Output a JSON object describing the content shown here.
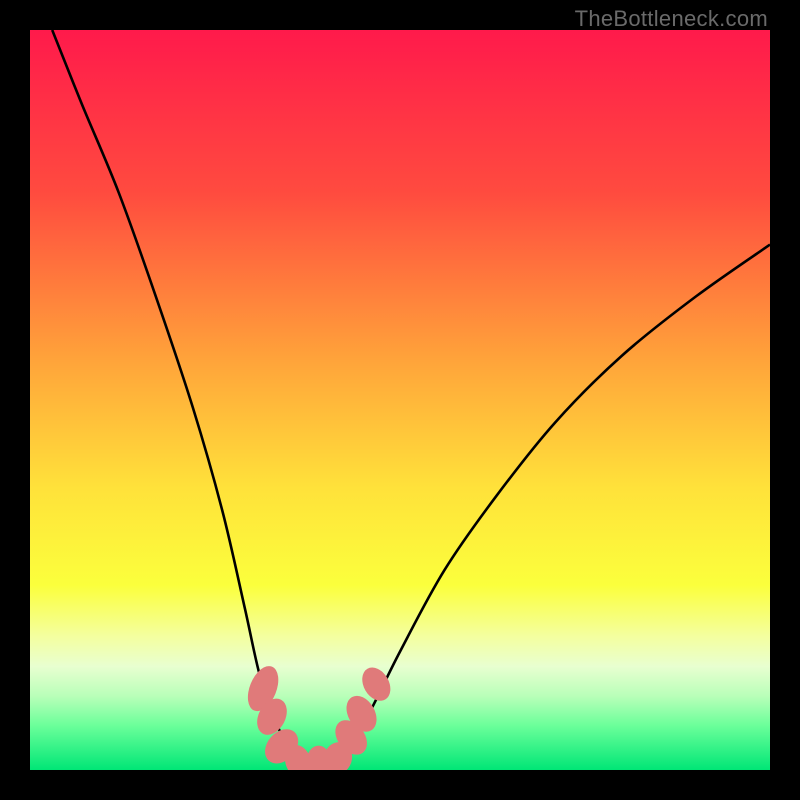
{
  "watermark": "TheBottleneck.com",
  "chart_data": {
    "type": "line",
    "title": "",
    "xlabel": "",
    "ylabel": "",
    "x_range": [
      0,
      100
    ],
    "y_range": [
      0,
      100
    ],
    "gradient_stops": [
      {
        "offset": 0,
        "color": "#ff1a4b"
      },
      {
        "offset": 22,
        "color": "#ff4b3f"
      },
      {
        "offset": 45,
        "color": "#ffa53a"
      },
      {
        "offset": 62,
        "color": "#ffe23a"
      },
      {
        "offset": 75,
        "color": "#fbff3c"
      },
      {
        "offset": 82,
        "color": "#f4ffa0"
      },
      {
        "offset": 86,
        "color": "#e8ffd0"
      },
      {
        "offset": 90,
        "color": "#b9ffb9"
      },
      {
        "offset": 94,
        "color": "#6bff9a"
      },
      {
        "offset": 100,
        "color": "#00e676"
      }
    ],
    "series": [
      {
        "name": "left-curve",
        "points": [
          {
            "x": 3,
            "y": 100
          },
          {
            "x": 7,
            "y": 90
          },
          {
            "x": 12,
            "y": 78
          },
          {
            "x": 17,
            "y": 64
          },
          {
            "x": 22,
            "y": 49
          },
          {
            "x": 26,
            "y": 35
          },
          {
            "x": 29,
            "y": 22
          },
          {
            "x": 31,
            "y": 13
          },
          {
            "x": 33,
            "y": 7
          },
          {
            "x": 35,
            "y": 3
          },
          {
            "x": 37,
            "y": 1
          }
        ]
      },
      {
        "name": "right-curve",
        "points": [
          {
            "x": 41,
            "y": 1
          },
          {
            "x": 43,
            "y": 3
          },
          {
            "x": 46,
            "y": 8
          },
          {
            "x": 50,
            "y": 16
          },
          {
            "x": 56,
            "y": 27
          },
          {
            "x": 63,
            "y": 37
          },
          {
            "x": 71,
            "y": 47
          },
          {
            "x": 80,
            "y": 56
          },
          {
            "x": 90,
            "y": 64
          },
          {
            "x": 100,
            "y": 71
          }
        ]
      }
    ],
    "markers": {
      "name": "bottom-markers",
      "color": "#e07a7a",
      "ellipses": [
        {
          "cx": 31.5,
          "cy": 11.0,
          "rx": 1.8,
          "ry": 3.2,
          "rot": 22
        },
        {
          "cx": 32.7,
          "cy": 7.2,
          "rx": 1.8,
          "ry": 2.6,
          "rot": 28
        },
        {
          "cx": 34.0,
          "cy": 3.2,
          "rx": 1.9,
          "ry": 2.6,
          "rot": 42
        },
        {
          "cx": 36.2,
          "cy": 1.2,
          "rx": 2.2,
          "ry": 1.7,
          "rot": 75
        },
        {
          "cx": 39.0,
          "cy": 0.9,
          "rx": 2.4,
          "ry": 1.7,
          "rot": 90
        },
        {
          "cx": 41.6,
          "cy": 1.6,
          "rx": 2.2,
          "ry": 1.9,
          "rot": 108
        },
        {
          "cx": 43.4,
          "cy": 4.4,
          "rx": 1.8,
          "ry": 2.6,
          "rot": 142
        },
        {
          "cx": 44.8,
          "cy": 7.6,
          "rx": 1.8,
          "ry": 2.6,
          "rot": 150
        },
        {
          "cx": 46.8,
          "cy": 11.6,
          "rx": 1.7,
          "ry": 2.4,
          "rot": 150
        }
      ]
    }
  }
}
